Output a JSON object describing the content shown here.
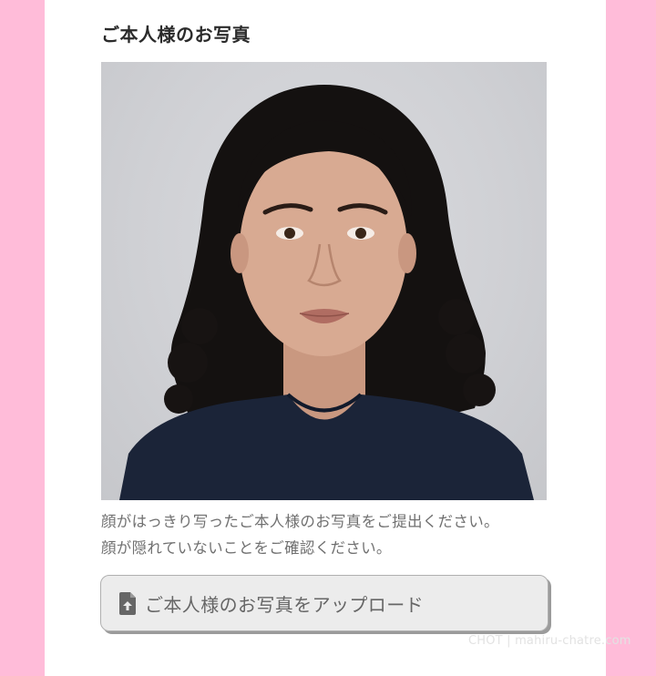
{
  "section": {
    "title": "ご本人様のお写真"
  },
  "photo": {
    "subject": "portrait-photo",
    "background_color": "#cfd0d4"
  },
  "instructions": {
    "line1": "顔がはっきり写ったご本人様のお写真をご提出ください。",
    "line2": "顔が隠れていないことをご確認ください。"
  },
  "upload": {
    "label": "ご本人様のお写真をアップロード",
    "icon": "file-upload-icon"
  },
  "watermark": {
    "text": "CHOT | mahiru-chatre.com"
  },
  "colors": {
    "page_background": "#ffbcd9",
    "panel_background": "#ffffff",
    "button_background": "#ececec"
  }
}
